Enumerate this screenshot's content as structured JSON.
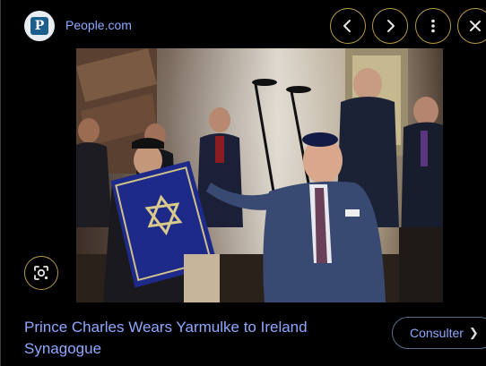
{
  "header": {
    "site_icon_letter": "P",
    "site_name": "People.com"
  },
  "toolbar": {
    "prev_icon": "chevron-left-icon",
    "next_icon": "chevron-right-icon",
    "more_icon": "more-vert-icon",
    "close_icon": "close-icon"
  },
  "image": {
    "alt": "Prince Charles Wears Yarmulke to Ireland Synagogue"
  },
  "lens": {
    "icon": "lens-icon"
  },
  "result": {
    "title": "Prince Charles Wears Yarmulke to Ireland Synagogue",
    "visit_label": "Consulter",
    "visit_icon": "chevron-right-icon"
  },
  "colors": {
    "background": "#000000",
    "link": "#8ea8ff",
    "button_border": "#b79a45",
    "site_tile": "#1d5f8c"
  }
}
